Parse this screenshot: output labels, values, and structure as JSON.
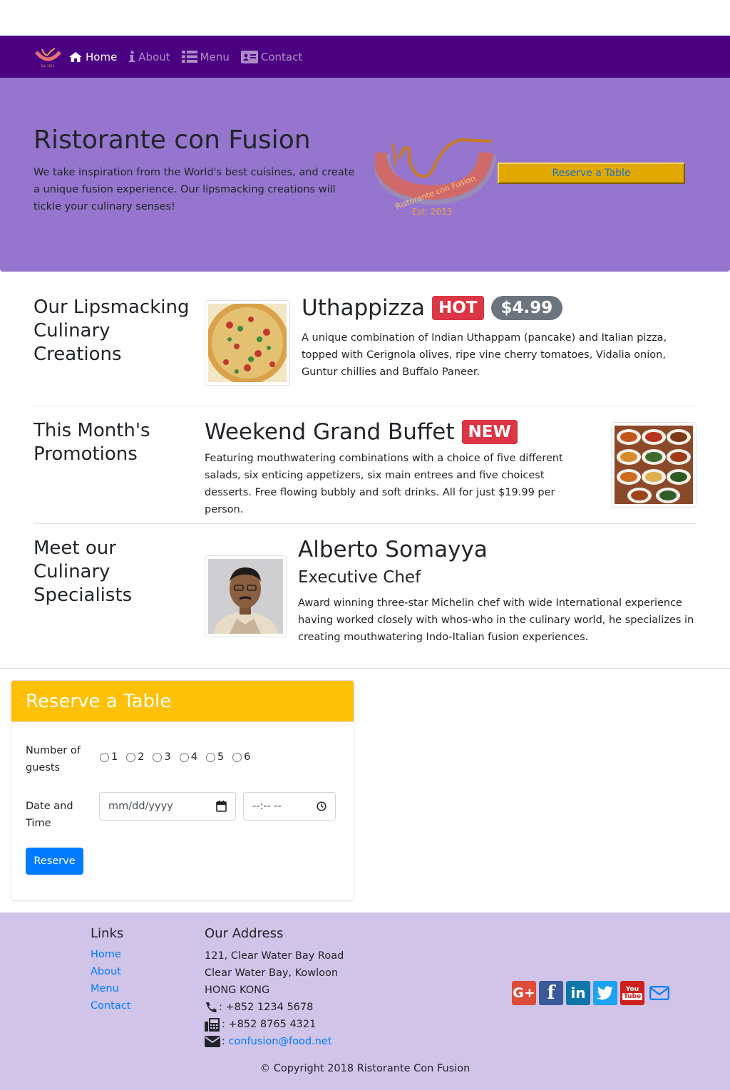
{
  "navbar": {
    "home": "Home",
    "about": "About",
    "menu": "Menu",
    "contact": "Contact"
  },
  "jumbotron": {
    "title": "Ristorante con Fusion",
    "text": "We take inspiration from the World's best cuisines, and create a unique fusion experience. Our lipsmacking creations will tickle your culinary senses!",
    "reserve_label": "Reserve a Table"
  },
  "sections": {
    "dish": {
      "heading": "Our Lipsmacking Culinary Creations",
      "name": "Uthappizza",
      "badge": "HOT",
      "price": "$4.99",
      "description": "A unique combination of Indian Uthappam (pancake) and Italian pizza, topped with Cerignola olives, ripe vine cherry tomatoes, Vidalia onion, Guntur chillies and Buffalo Paneer."
    },
    "promotion": {
      "heading": "This Month's Promotions",
      "name": "Weekend Grand Buffet",
      "badge": "NEW",
      "description": "Featuring mouthwatering combinations with a choice of five different salads, six enticing appetizers, six main entrees and five choicest desserts. Free flowing bubbly and soft drinks. All for just $19.99 per person."
    },
    "leader": {
      "heading": "Meet our Culinary Specialists",
      "name": "Alberto Somayya",
      "designation": "Executive Chef",
      "description": "Award winning three-star Michelin chef with wide International experience having worked closely with whos-who in the culinary world, he specializes in creating mouthwatering Indo-Italian fusion experiences."
    }
  },
  "reservation": {
    "title": "Reserve a Table",
    "guests_label": "Number of guests",
    "guest_options": [
      "1",
      "2",
      "3",
      "4",
      "5",
      "6"
    ],
    "datetime_label": "Date and Time",
    "date_placeholder": "mm/dd/yyyy",
    "time_placeholder": "--:-- --",
    "submit_label": "Reserve"
  },
  "footer": {
    "links_heading": "Links",
    "links": [
      "Home",
      "About",
      "Menu",
      "Contact"
    ],
    "address_heading": "Our Address",
    "address_lines": [
      "121, Clear Water Bay Road",
      "Clear Water Bay, Kowloon",
      "HONG KONG"
    ],
    "phone": ": +852 1234 5678",
    "fax": ": +852 8765 4321",
    "email_prefix": ":",
    "email": "confusion@food.net",
    "social_icons": [
      "google-plus-icon",
      "facebook-icon",
      "linkedin-icon",
      "twitter-icon",
      "youtube-icon",
      "envelope-icon"
    ],
    "copyright": "© Copyright 2018 Ristorante Con Fusion"
  },
  "colors": {
    "navbar": "#4b0082",
    "jumbotron": "#9575cd",
    "footer": "#d1c4e9",
    "reserve_header": "#ffc107",
    "primary": "#007bff",
    "danger": "#dc3545"
  }
}
